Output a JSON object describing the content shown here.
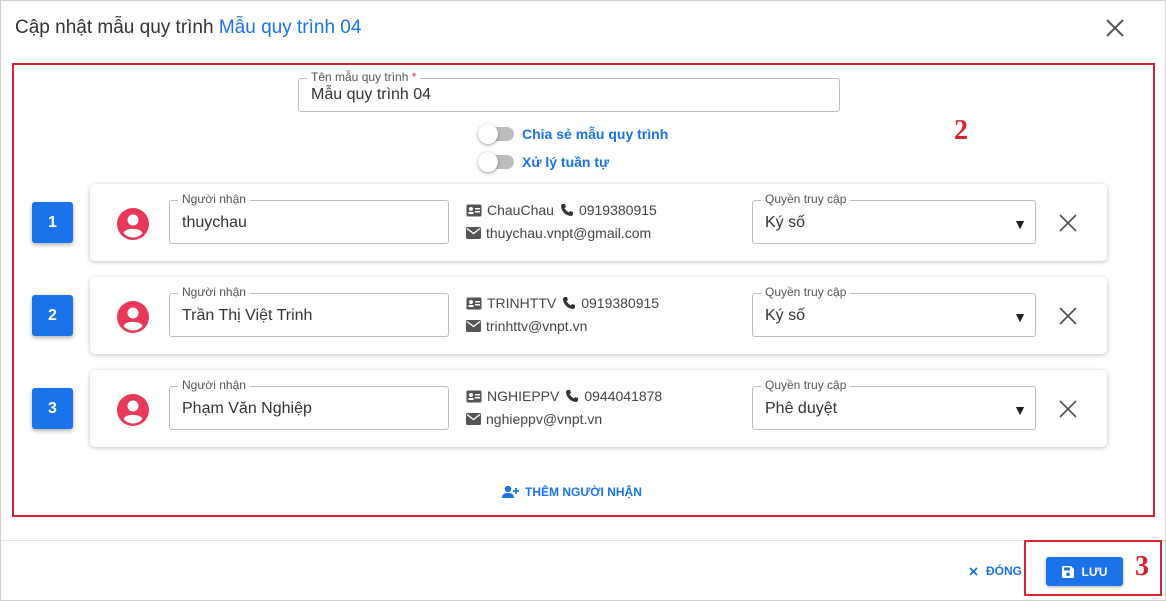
{
  "dialog": {
    "title_prefix": "Cập nhật mẫu quy trình",
    "title_highlight": "Mẫu quy trình 04"
  },
  "form": {
    "template_name_label": "Tên mẫu quy trình",
    "required_mark": "*",
    "template_name_value": "Mẫu quy trình 04",
    "share_label": "Chia sẻ mẫu quy trình",
    "share_enabled": false,
    "sequential_label": "Xử lý tuần tự",
    "sequential_enabled": false
  },
  "recipients": [
    {
      "index": "1",
      "recipient_label": "Người nhận",
      "recipient_value": "thuychau",
      "username": "ChauChau",
      "phone": "0919380915",
      "email": "thuychau.vnpt@gmail.com",
      "access_label": "Quyền truy cập",
      "access_value": "Ký số"
    },
    {
      "index": "2",
      "recipient_label": "Người nhận",
      "recipient_value": "Trần Thị Việt Trinh",
      "username": "TRINHTTV",
      "phone": "0919380915",
      "email": "trinhttv@vnpt.vn",
      "access_label": "Quyền truy cập",
      "access_value": "Ký số"
    },
    {
      "index": "3",
      "recipient_label": "Người nhận",
      "recipient_value": "Phạm Văn Nghiệp",
      "username": "NGHIEPPV",
      "phone": "0944041878",
      "email": "nghieppv@vnpt.vn",
      "access_label": "Quyền truy cập",
      "access_value": "Phê duyệt"
    }
  ],
  "actions": {
    "add_recipient": "THÊM NGƯỜI NHẬN",
    "close": "ĐÓNG",
    "save": "LƯU"
  },
  "annotations": {
    "main_area": "2",
    "save_area": "3"
  },
  "icons": {
    "close": "close-icon",
    "avatar": "account-circle-icon",
    "id_card": "id-card-icon",
    "phone": "phone-icon",
    "email": "envelope-icon",
    "dropdown": "caret-down-icon",
    "add_user": "user-plus-icon",
    "save": "floppy-disk-icon"
  },
  "colors": {
    "primary": "#1a73e8",
    "annotation": "#d6232f",
    "avatar": "#e8385a"
  }
}
